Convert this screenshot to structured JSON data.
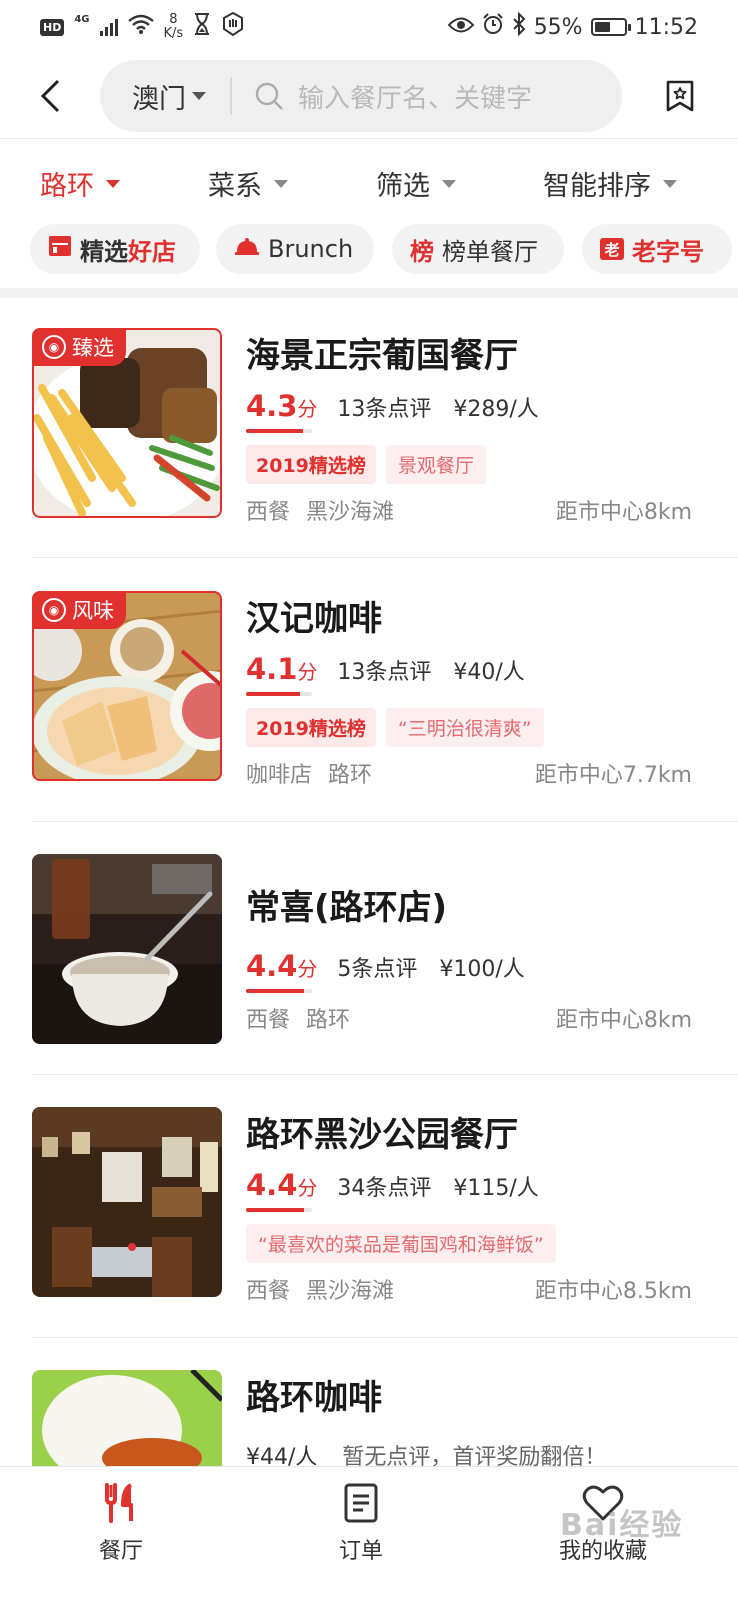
{
  "status_bar": {
    "hd": "HD",
    "network": "4G",
    "speed_value": "8",
    "speed_unit": "K/s",
    "battery": "55%",
    "battery_level": 0.55,
    "time": "11:52"
  },
  "header": {
    "city": "澳门",
    "search_placeholder": "输入餐厅名、关键字"
  },
  "filters": [
    {
      "label": "路环",
      "active": true
    },
    {
      "label": "菜系",
      "active": false
    },
    {
      "label": "筛选",
      "active": false
    },
    {
      "label": "智能排序",
      "active": false
    }
  ],
  "tags": {
    "t1a": "精选",
    "t1b": "好店",
    "t2": "Brunch",
    "t3_icon": "榜",
    "t3": "榜单餐厅",
    "t4_icon": "老",
    "t4": "老字号"
  },
  "restaurants": [
    {
      "name": "海景正宗葡国餐厅",
      "badge": "臻选",
      "score": "4.3",
      "score_unit": "分",
      "score_value": 4.3,
      "reviews": "13条点评",
      "price": "¥289/人",
      "tag1": "2019精选榜",
      "tag2": "景观餐厅",
      "cuisine": "西餐",
      "area": "黑沙海滩",
      "distance": "距市中心8km"
    },
    {
      "name": "汉记咖啡",
      "badge": "风味",
      "score": "4.1",
      "score_unit": "分",
      "score_value": 4.1,
      "reviews": "13条点评",
      "price": "¥40/人",
      "tag1": "2019精选榜",
      "tag2": "“三明治很清爽”",
      "cuisine": "咖啡店",
      "area": "路环",
      "distance": "距市中心7.7km"
    },
    {
      "name": "常喜(路环店)",
      "score": "4.4",
      "score_unit": "分",
      "score_value": 4.4,
      "reviews": "5条点评",
      "price": "¥100/人",
      "cuisine": "西餐",
      "area": "路环",
      "distance": "距市中心8km"
    },
    {
      "name": "路环黑沙公园餐厅",
      "score": "4.4",
      "score_unit": "分",
      "score_value": 4.4,
      "reviews": "34条点评",
      "price": "¥115/人",
      "tag2": "“最喜欢的菜品是葡国鸡和海鲜饭”",
      "cuisine": "西餐",
      "area": "黑沙海滩",
      "distance": "距市中心8.5km"
    },
    {
      "name": "路环咖啡",
      "price": "¥44/人",
      "no_review": "暂无点评，首评奖励翻倍！"
    }
  ],
  "bottom_nav": [
    {
      "label": "餐厅",
      "icon": "fork-knife-icon"
    },
    {
      "label": "订单",
      "icon": "document-icon"
    },
    {
      "label": "我的收藏",
      "icon": "heart-icon"
    }
  ],
  "watermark": "Bai经验",
  "colors": {
    "accent": "#e0312f",
    "pill_bg": "#fde9ea",
    "muted_text": "#888888"
  }
}
